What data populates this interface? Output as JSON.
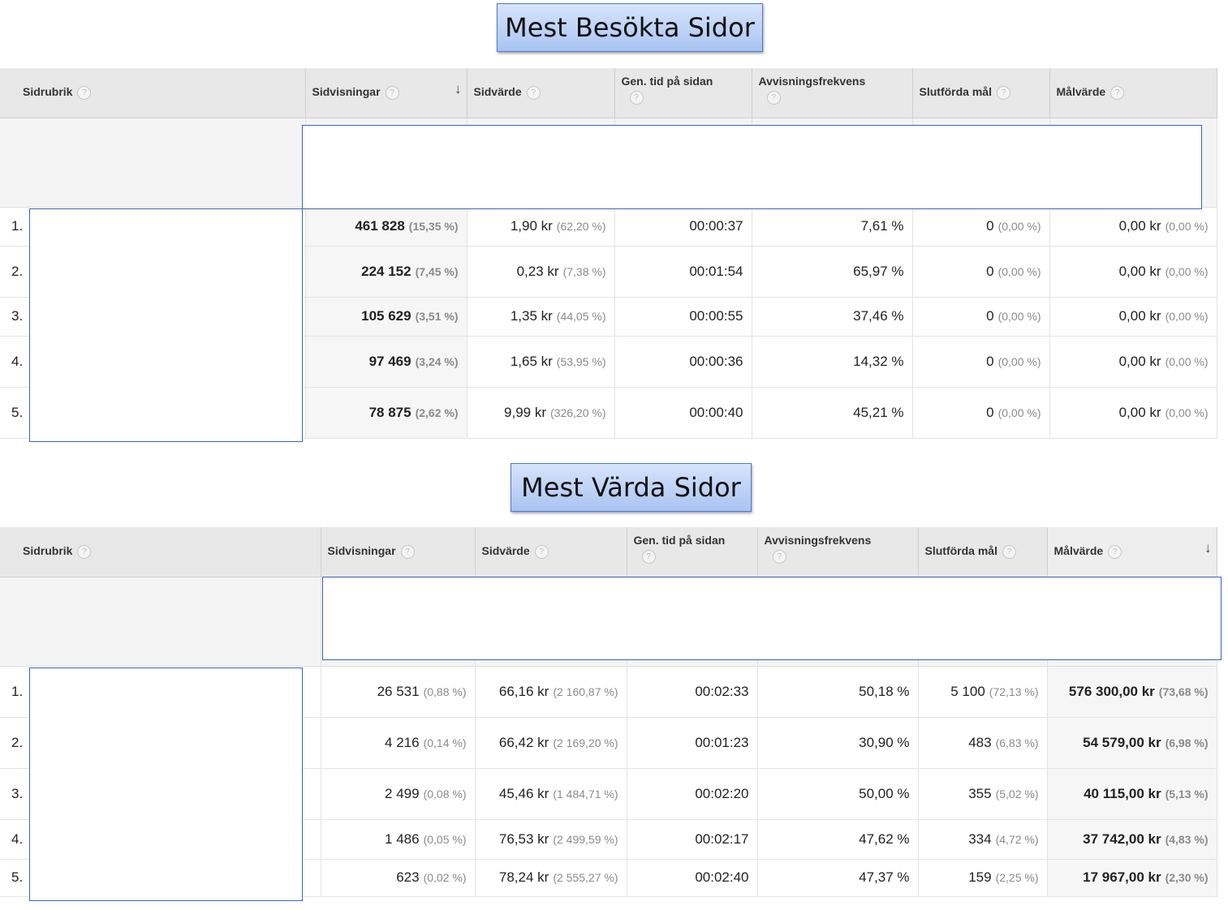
{
  "sections": [
    {
      "title": "Mest Besökta Sidor",
      "headers": [
        "Sidrubrik",
        "Sidvisningar",
        "Sidvärde",
        "Gen. tid på sidan",
        "Avvisningsfrekvens",
        "Slutförda mål",
        "Målvärde"
      ],
      "help_glyph": "?",
      "sort_glyph": "↓",
      "rows": [
        {
          "rank": "1.",
          "sidvisningar": "461 828",
          "sidvisningar_pct": "(15,35 %)",
          "sidvarde": "1,90 kr",
          "sidvarde_pct": "(62,20 %)",
          "tid": "00:00:37",
          "avvisning": "7,61 %",
          "mal": "0",
          "mal_pct": "(0,00 %)",
          "malvarde": "0,00 kr",
          "malvarde_pct": "(0,00 %)"
        },
        {
          "rank": "2.",
          "sidvisningar": "224 152",
          "sidvisningar_pct": "(7,45 %)",
          "sidvarde": "0,23 kr",
          "sidvarde_pct": "(7,38 %)",
          "tid": "00:01:54",
          "avvisning": "65,97 %",
          "mal": "0",
          "mal_pct": "(0,00 %)",
          "malvarde": "0,00 kr",
          "malvarde_pct": "(0,00 %)"
        },
        {
          "rank": "3.",
          "sidvisningar": "105 629",
          "sidvisningar_pct": "(3,51 %)",
          "sidvarde": "1,35 kr",
          "sidvarde_pct": "(44,05 %)",
          "tid": "00:00:55",
          "avvisning": "37,46 %",
          "mal": "0",
          "mal_pct": "(0,00 %)",
          "malvarde": "0,00 kr",
          "malvarde_pct": "(0,00 %)"
        },
        {
          "rank": "4.",
          "sidvisningar": "97 469",
          "sidvisningar_pct": "(3,24 %)",
          "sidvarde": "1,65 kr",
          "sidvarde_pct": "(53,95 %)",
          "tid": "00:00:36",
          "avvisning": "14,32 %",
          "mal": "0",
          "mal_pct": "(0,00 %)",
          "malvarde": "0,00 kr",
          "malvarde_pct": "(0,00 %)"
        },
        {
          "rank": "5.",
          "sidvisningar": "78 875",
          "sidvisningar_pct": "(2,62 %)",
          "sidvarde": "9,99 kr",
          "sidvarde_pct": "(326,20 %)",
          "tid": "00:00:40",
          "avvisning": "45,21 %",
          "mal": "0",
          "mal_pct": "(0,00 %)",
          "malvarde": "0,00 kr",
          "malvarde_pct": "(0,00 %)"
        }
      ]
    },
    {
      "title": "Mest Värda Sidor",
      "headers": [
        "Sidrubrik",
        "Sidvisningar",
        "Sidvärde",
        "Gen. tid på sidan",
        "Avvisningsfrekvens",
        "Slutförda mål",
        "Målvärde"
      ],
      "help_glyph": "?",
      "sort_glyph": "↓",
      "rows": [
        {
          "rank": "1.",
          "sidvisningar": "26 531",
          "sidvisningar_pct": "(0,88 %)",
          "sidvarde": "66,16 kr",
          "sidvarde_pct": "(2 160,87 %)",
          "tid": "00:02:33",
          "avvisning": "50,18 %",
          "mal": "5 100",
          "mal_pct": "(72,13 %)",
          "malvarde": "576 300,00 kr",
          "malvarde_pct": "(73,68 %)"
        },
        {
          "rank": "2.",
          "sidvisningar": "4 216",
          "sidvisningar_pct": "(0,14 %)",
          "sidvarde": "66,42 kr",
          "sidvarde_pct": "(2 169,20 %)",
          "tid": "00:01:23",
          "avvisning": "30,90 %",
          "mal": "483",
          "mal_pct": "(6,83 %)",
          "malvarde": "54 579,00 kr",
          "malvarde_pct": "(6,98 %)"
        },
        {
          "rank": "3.",
          "sidvisningar": "2 499",
          "sidvisningar_pct": "(0,08 %)",
          "sidvarde": "45,46 kr",
          "sidvarde_pct": "(1 484,71 %)",
          "tid": "00:02:20",
          "avvisning": "50,00 %",
          "mal": "355",
          "mal_pct": "(5,02 %)",
          "malvarde": "40 115,00 kr",
          "malvarde_pct": "(5,13 %)"
        },
        {
          "rank": "4.",
          "sidvisningar": "1 486",
          "sidvisningar_pct": "(0,05 %)",
          "sidvarde": "76,53 kr",
          "sidvarde_pct": "(2 499,59 %)",
          "tid": "00:02:17",
          "avvisning": "47,62 %",
          "mal": "334",
          "mal_pct": "(4,72 %)",
          "malvarde": "37 742,00 kr",
          "malvarde_pct": "(4,83 %)"
        },
        {
          "rank": "5.",
          "sidvisningar": "623",
          "sidvisningar_pct": "(0,02 %)",
          "sidvarde": "78,24 kr",
          "sidvarde_pct": "(2 555,27 %)",
          "tid": "00:02:40",
          "avvisning": "47,37 %",
          "mal": "159",
          "mal_pct": "(2,25 %)",
          "malvarde": "17 967,00 kr",
          "malvarde_pct": "(2,30 %)"
        }
      ]
    }
  ]
}
